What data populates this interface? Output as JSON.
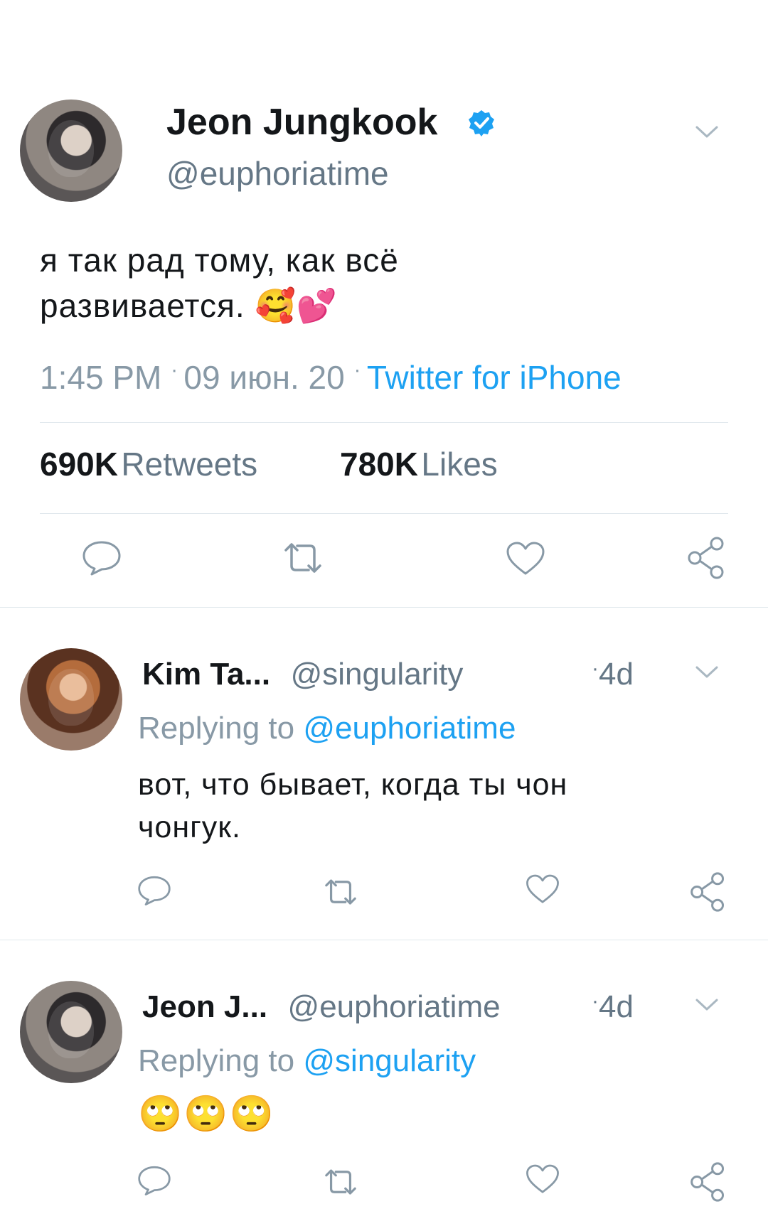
{
  "main_tweet": {
    "author_name": "Jeon Jungkook",
    "author_handle": "@euphoriatime",
    "text_line1": "я так рад тому, как всё",
    "text_line2": "развивается.",
    "emojis": "🥰💕",
    "time": "1:45 PM",
    "date": "09 июн. 20",
    "source": "Twitter for iPhone",
    "retweets_count": "690K",
    "retweets_label": "Retweets",
    "likes_count": "780K",
    "likes_label": "Likes"
  },
  "replies": [
    {
      "name": "Kim Ta...",
      "handle": "@singularity",
      "time": "4d",
      "replying_prefix": "Replying to",
      "replying_to": "@euphoriatime",
      "text_line1": "вот, что бывает, когда ты чон",
      "text_line2": "чонгук.",
      "emojis": ""
    },
    {
      "name": "Jeon J...",
      "handle": "@euphoriatime",
      "time": "4d",
      "replying_prefix": "Replying to",
      "replying_to": "@singularity",
      "text_line1": "",
      "text_line2": "",
      "emojis": "🙄🙄🙄"
    }
  ],
  "colors": {
    "accent": "#1da1f2",
    "text": "#14171a",
    "muted": "#8899a6",
    "divider": "#e1e8ed"
  },
  "icons": [
    "chevron-down-icon",
    "verified-badge-icon",
    "reply-icon",
    "retweet-icon",
    "like-icon",
    "share-icon"
  ]
}
